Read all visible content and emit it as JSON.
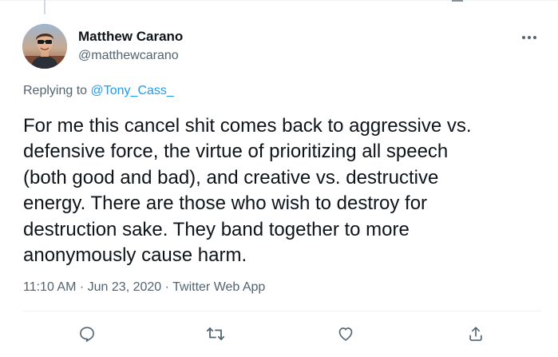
{
  "tweet": {
    "author": {
      "display_name": "Matthew Carano",
      "handle": "@matthewcarano"
    },
    "replying_prefix": "Replying to",
    "replying_to": "@Tony_Cass_",
    "text": "For me this cancel shit comes back to aggressive vs.\ndefensive force, the virtue of prioritizing all speech\n(both good and bad), and creative vs. destructive\nenergy. There are those who wish to destroy for\ndestruction sake. They band together to more\nanonymously cause harm.",
    "time": "11:10 AM",
    "date": "Jun 23, 2020",
    "source": "Twitter Web App",
    "separator": "·"
  },
  "actions": {
    "reply_icon": "reply-icon",
    "retweet_icon": "retweet-icon",
    "like_icon": "like-icon",
    "share_icon": "share-icon"
  },
  "colors": {
    "text": "#0f1419",
    "secondary": "#536471",
    "link": "#1d9bf0",
    "divider": "#eff3f4"
  }
}
